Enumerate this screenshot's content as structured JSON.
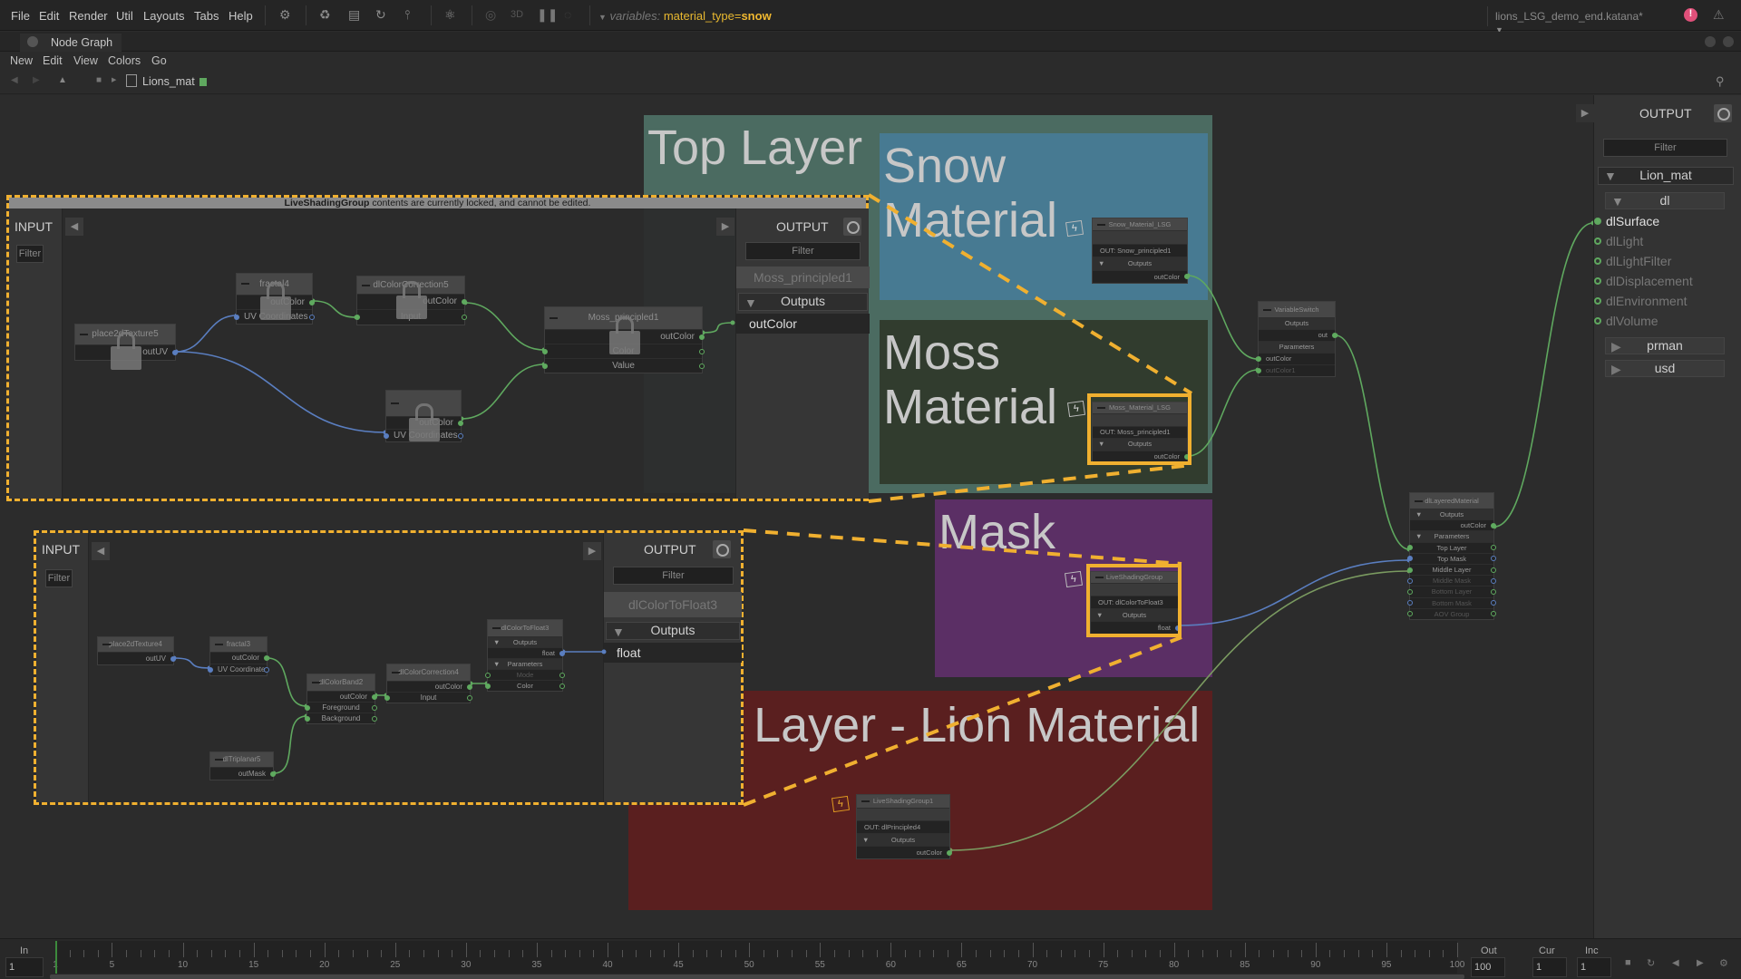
{
  "menubar": {
    "items": [
      "File",
      "Edit",
      "Render",
      "Util",
      "Layouts",
      "Tabs",
      "Help"
    ],
    "toolbar_3d": "3D",
    "variables_label": "variables:",
    "variable_name": "material_type",
    "variable_equals": "=",
    "variable_value": "snow",
    "project": "lions_LSG_demo_end.katana*",
    "alert_color": "#e0507a"
  },
  "tab": {
    "title": "Node Graph"
  },
  "graph_menu": [
    "New",
    "Edit",
    "View",
    "Colors",
    "Go"
  ],
  "breadcrumb": {
    "path": "Lions_mat"
  },
  "backdrops": {
    "top_layer": {
      "title": "Top Layer",
      "color": "#4b6b61"
    },
    "snow": {
      "title": "Snow\nMaterial",
      "color": "#477a92"
    },
    "moss": {
      "title": "Moss\nMaterial",
      "color": "#313c2e"
    },
    "mask": {
      "title": "Mask",
      "color": "#5b2f65"
    },
    "base": {
      "title": "Base Layer - Lion Material",
      "color": "#5a1f1f"
    }
  },
  "locked_message": {
    "bold": "LiveShadingGroup",
    "rest": " contents are currently locked, and cannot be edited."
  },
  "overlay_moss": {
    "input_label": "INPUT",
    "output_label": "OUTPUT",
    "filter_placeholder": "Filter",
    "output_node": "Moss_principled1",
    "outputs_section": "Outputs",
    "output_port": "outColor"
  },
  "overlay_mask": {
    "input_label": "INPUT",
    "output_label": "OUTPUT",
    "filter_placeholder": "Filter",
    "output_node": "dlColorToFloat3",
    "outputs_section": "Outputs",
    "output_port": "float"
  },
  "nodes": {
    "place2dTexture5": {
      "title": "place2dTexture5",
      "locked": true,
      "rows": [
        {
          "label": "outUV",
          "align": "right",
          "out": "uv"
        }
      ]
    },
    "fractal4": {
      "title": "fractal4",
      "locked": true,
      "rows": [
        {
          "label": "outColor",
          "align": "right",
          "out": "color"
        },
        {
          "label": "UV Coordinates",
          "align": "left",
          "in": "uv",
          "out": "uv-o"
        }
      ]
    },
    "dlColorCorrection5": {
      "title": "dlColorCorrection5",
      "locked": true,
      "rows": [
        {
          "label": "outColor",
          "align": "right",
          "out": "color"
        },
        {
          "label": "Input",
          "align": "center",
          "in": "color",
          "out": "color-o"
        }
      ]
    },
    "fractal_locked": {
      "title": "",
      "locked": true,
      "rows": [
        {
          "label": "outColor",
          "align": "right",
          "out": "color"
        },
        {
          "label": "UV Coordinates",
          "align": "left",
          "in": "uv",
          "out": "uv-o"
        }
      ]
    },
    "Moss_principled1": {
      "title": "Moss_principled1",
      "locked": true,
      "rows": [
        {
          "label": "outColor",
          "align": "right",
          "out": "color"
        },
        {
          "label": "Color",
          "align": "center",
          "in": "color",
          "out": "color-o"
        },
        {
          "label": "Value",
          "align": "center",
          "in": "color",
          "out": "color-o"
        }
      ]
    },
    "place2dTexture4": {
      "title": "place2dTexture4",
      "rows": [
        {
          "label": "outUV",
          "align": "right",
          "out": "uv"
        }
      ]
    },
    "fractal3": {
      "title": "fractal3",
      "rows": [
        {
          "label": "outColor",
          "align": "right",
          "out": "color"
        },
        {
          "label": "UV Coordinates",
          "align": "left",
          "in": "uv",
          "out": "uv-o"
        }
      ]
    },
    "dlColorBand2": {
      "title": "dlColorBand2",
      "rows": [
        {
          "label": "outColor",
          "align": "right",
          "out": "color"
        },
        {
          "label": "Foreground",
          "align": "center",
          "in": "color",
          "out": "color-o"
        },
        {
          "label": "Background",
          "align": "center",
          "in": "color",
          "out": "color-o"
        }
      ]
    },
    "dlTriplanar5": {
      "title": "dlTriplanar5",
      "rows": [
        {
          "label": "outMask",
          "align": "right",
          "out": "color"
        }
      ]
    },
    "dlColorCorrection4": {
      "title": "dlColorCorrection4",
      "rows": [
        {
          "label": "outColor",
          "align": "right",
          "out": "color"
        },
        {
          "label": "Input",
          "align": "center",
          "in": "color",
          "out": "color-o"
        }
      ]
    },
    "dlColorToFloat3": {
      "title": "dlColorToFloat3",
      "rows": [
        {
          "label": "Outputs",
          "kind": "sec",
          "arrow": "▼"
        },
        {
          "label": "float",
          "align": "right",
          "out": "uv"
        },
        {
          "label": "Parameters",
          "kind": "sec",
          "arrow": "▼"
        },
        {
          "label": "Mode",
          "align": "center",
          "dim": true,
          "in": "color-o",
          "out": "color-o"
        },
        {
          "label": "Color",
          "align": "center",
          "in": "color",
          "out": "color-o"
        }
      ]
    },
    "Snow_Material_LSG": {
      "title": "Snow_Material_LSG",
      "rows": [
        {
          "label": "",
          "kind": "blank"
        },
        {
          "label": "OUT: Snow_principled1",
          "align": "left"
        },
        {
          "label": "Outputs",
          "kind": "sec",
          "arrow": "▼"
        },
        {
          "label": "outColor",
          "align": "right",
          "out": "color"
        }
      ]
    },
    "Moss_Material_LSG": {
      "title": "Moss_Material_LSG",
      "rows": [
        {
          "label": "",
          "kind": "blank"
        },
        {
          "label": "OUT: Moss_principled1",
          "align": "left"
        },
        {
          "label": "Outputs",
          "kind": "sec",
          "arrow": "▼"
        },
        {
          "label": "outColor",
          "align": "right",
          "out": "color"
        }
      ]
    },
    "LiveShadingGroup": {
      "title": "LiveShadingGroup",
      "rows": [
        {
          "label": "",
          "kind": "blank"
        },
        {
          "label": "OUT: dlColorToFloat3",
          "align": "left"
        },
        {
          "label": "Outputs",
          "kind": "sec",
          "arrow": "▼"
        },
        {
          "label": "float",
          "align": "right",
          "out": "uv"
        }
      ]
    },
    "LiveShadingGroup1": {
      "title": "LiveShadingGroup1",
      "rows": [
        {
          "label": "",
          "kind": "blank"
        },
        {
          "label": "OUT: dlPrincipled4",
          "align": "left"
        },
        {
          "label": "Outputs",
          "kind": "sec",
          "arrow": "▼"
        },
        {
          "label": "outColor",
          "align": "right",
          "out": "color"
        }
      ]
    },
    "VariableSwitch": {
      "title": "VariableSwitch",
      "rows": [
        {
          "label": "Outputs",
          "kind": "sec"
        },
        {
          "label": "out",
          "align": "right",
          "out": "color"
        },
        {
          "label": "Parameters",
          "kind": "sec"
        },
        {
          "label": "outColor",
          "align": "left",
          "in": "color"
        },
        {
          "label": "outColor1",
          "align": "left",
          "dim": true,
          "in": "color"
        }
      ]
    },
    "dlLayeredMaterial": {
      "title": "dlLayeredMaterial",
      "rows": [
        {
          "label": "Outputs",
          "kind": "sec",
          "arrow": "▼"
        },
        {
          "label": "outColor",
          "align": "right",
          "out": "color"
        },
        {
          "label": "Parameters",
          "kind": "sec",
          "arrow": "▼"
        },
        {
          "label": "Top Layer",
          "align": "center",
          "in": "color",
          "out": "color-o"
        },
        {
          "label": "Top Mask",
          "align": "center",
          "in": "uv",
          "out": "uv-o"
        },
        {
          "label": "Middle Layer",
          "align": "center",
          "in": "color",
          "out": "color-o"
        },
        {
          "label": "Middle Mask",
          "align": "center",
          "dim": true,
          "in": "uv-o",
          "out": "uv-o"
        },
        {
          "label": "Bottom Layer",
          "align": "center",
          "dim": true,
          "in": "color-o",
          "out": "color-o"
        },
        {
          "label": "Bottom Mask",
          "align": "center",
          "dim": true,
          "in": "uv-o",
          "out": "uv-o"
        },
        {
          "label": "AOV Group",
          "align": "center",
          "dim": true,
          "in": "color-o",
          "out": "color-o"
        }
      ]
    }
  },
  "output_panel": {
    "title": "OUTPUT",
    "filter_placeholder": "Filter",
    "material": "Lion_mat",
    "group": "dl",
    "terminals": [
      {
        "label": "dlSurface",
        "connected": true
      },
      {
        "label": "dlLight",
        "connected": false
      },
      {
        "label": "dlLightFilter",
        "connected": false
      },
      {
        "label": "dlDisplacement",
        "connected": false
      },
      {
        "label": "dlEnvironment",
        "connected": false
      },
      {
        "label": "dlVolume",
        "connected": false
      }
    ],
    "collapsed_groups": [
      "prman",
      "usd"
    ]
  },
  "timeline": {
    "in_label": "In",
    "in_value": "1",
    "out_label": "Out",
    "out_value": "100",
    "cur_label": "Cur",
    "cur_value": "1",
    "inc_label": "Inc",
    "inc_value": "1",
    "range": [
      1,
      100
    ],
    "current_frame": 1,
    "tick_labels": [
      "1",
      "5",
      "10",
      "15",
      "20",
      "25",
      "30",
      "35",
      "40",
      "45",
      "50",
      "55",
      "60",
      "65",
      "70",
      "75",
      "80",
      "85",
      "90",
      "95",
      "100"
    ]
  },
  "colors": {
    "accent": "#f0b030",
    "port_color": "#5faa5f",
    "port_float": "#5a7ec0"
  }
}
